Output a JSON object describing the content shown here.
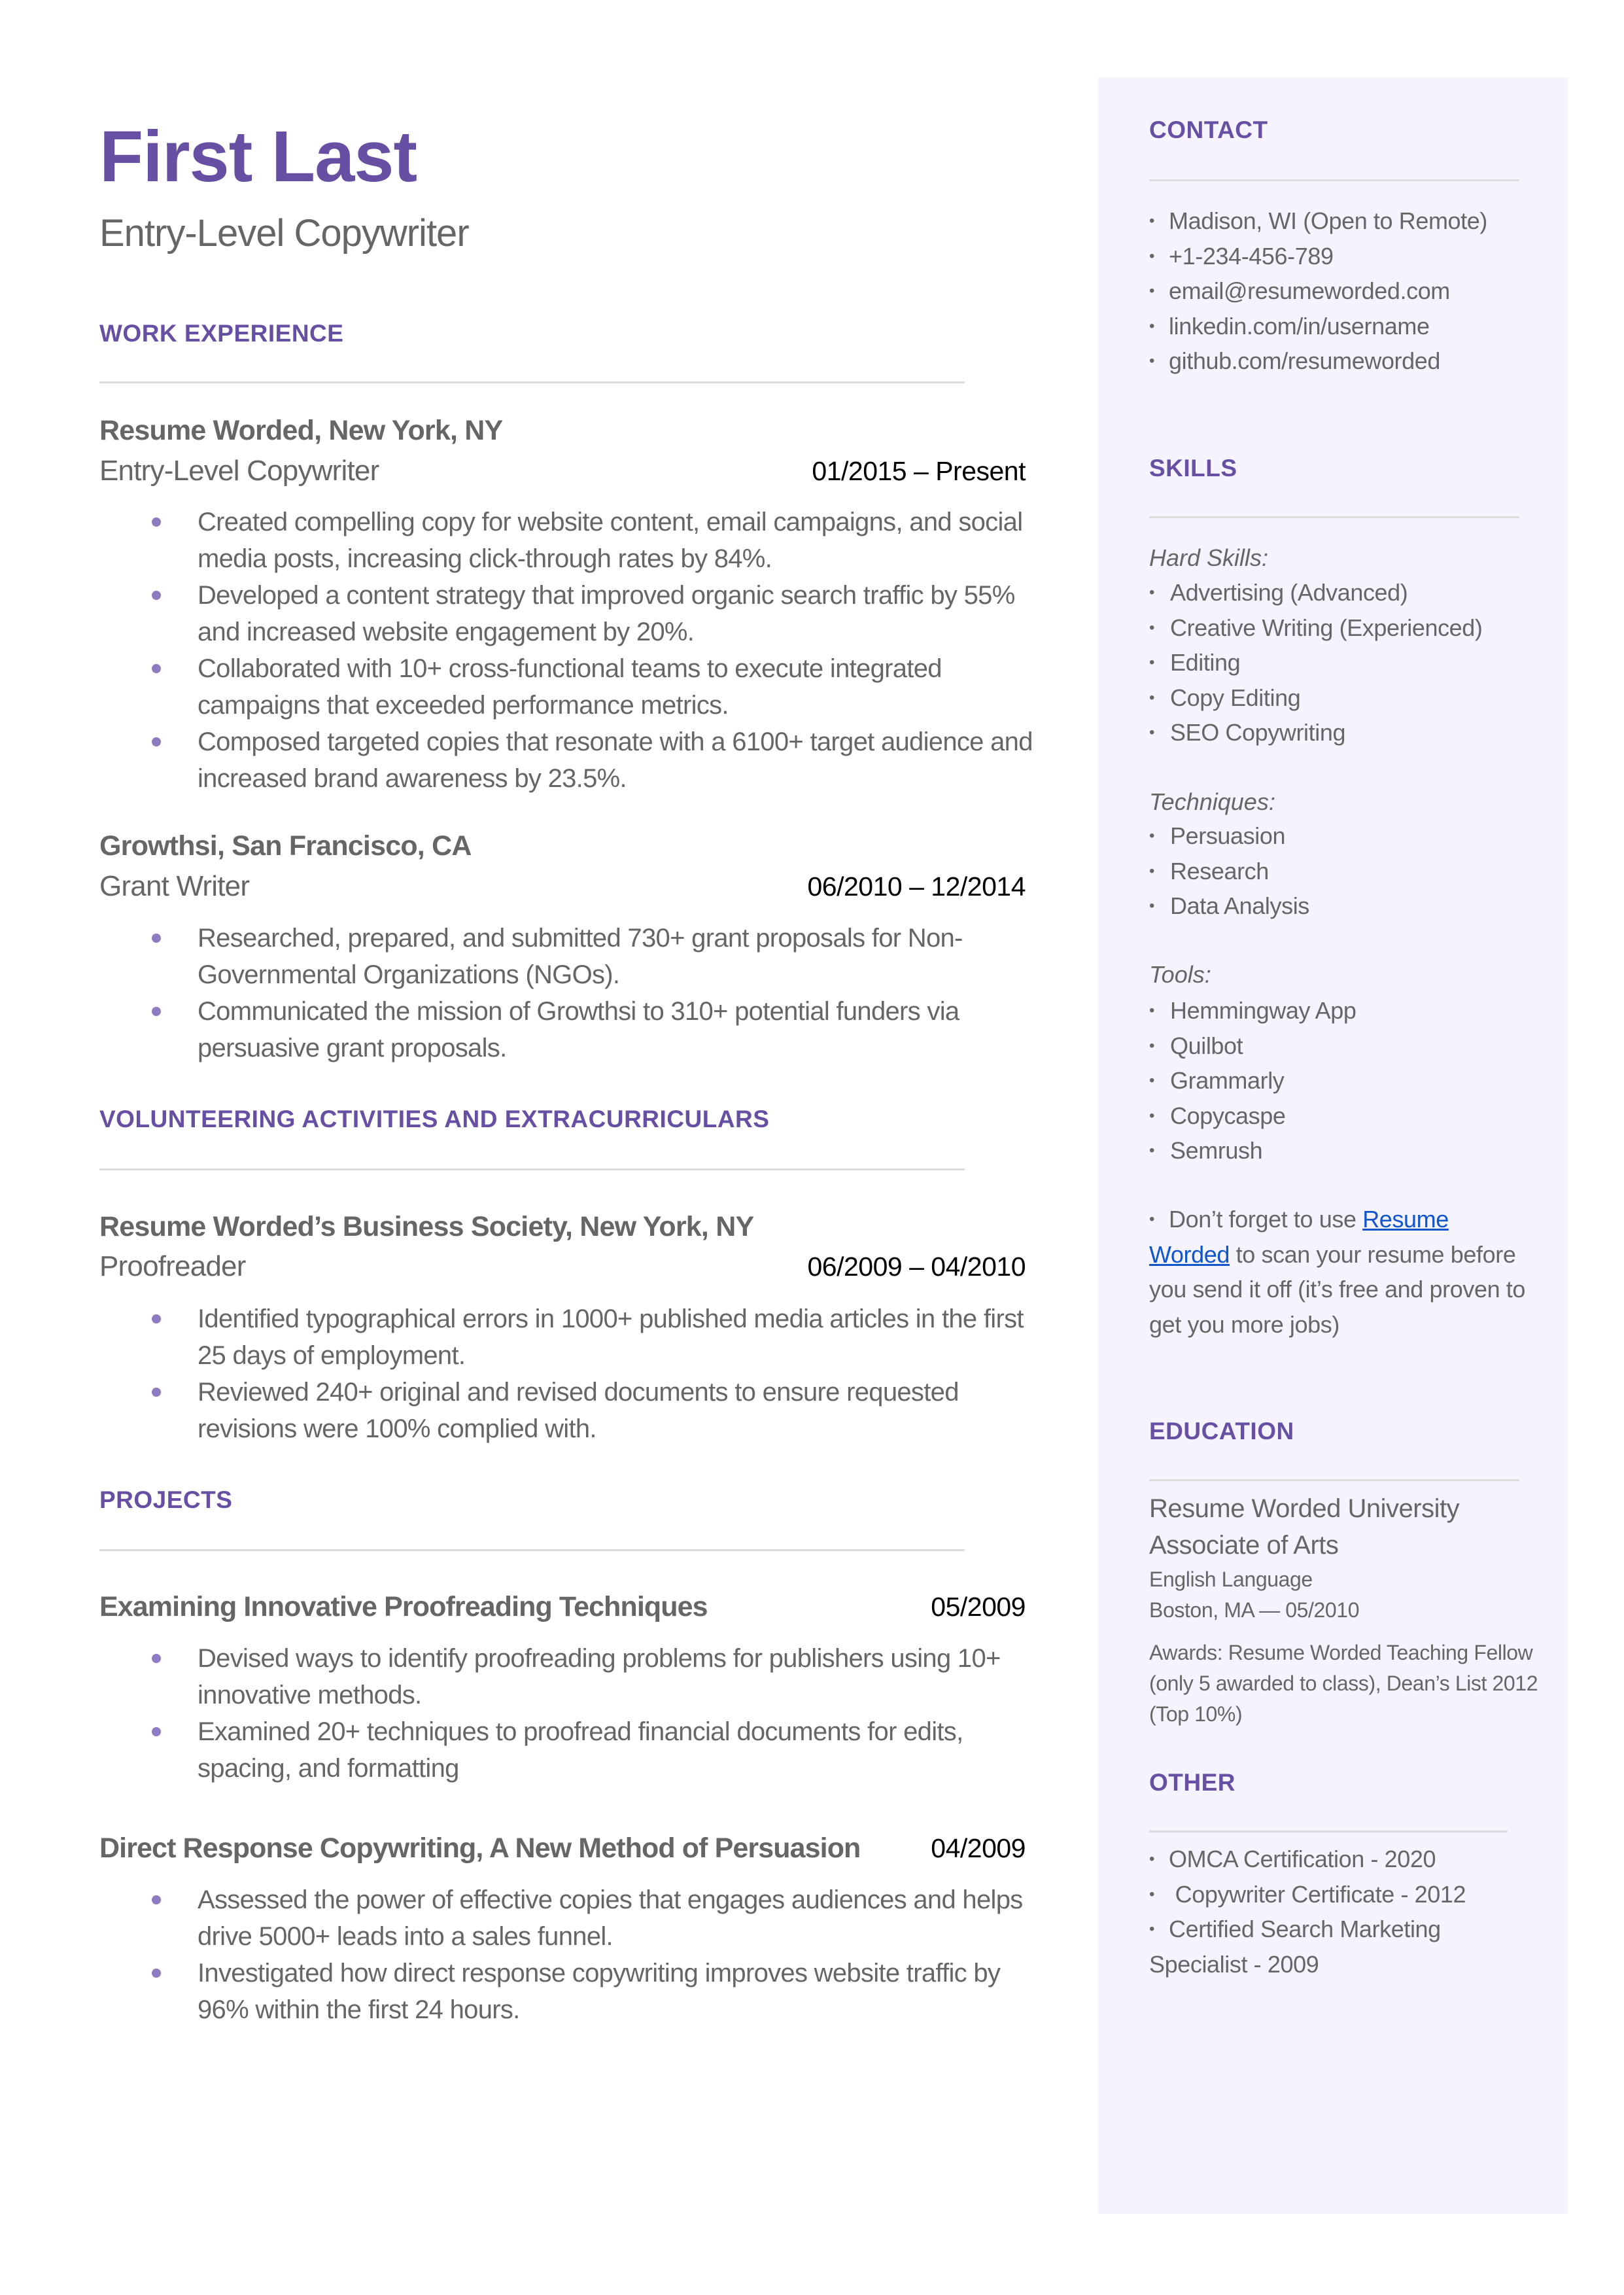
{
  "header": {
    "name": "First Last",
    "headline": "Entry-Level Copywriter"
  },
  "colors": {
    "accent": "#6750A4",
    "bullet": "#8E7CC3",
    "text": "#666666",
    "date": "#000000",
    "sidebar_bg": "#F5F3FE",
    "link": "#1155CC"
  },
  "work_experience": {
    "title": "WORK EXPERIENCE",
    "jobs": [
      {
        "org": "Resume Worded, New York, NY",
        "role": "Entry-Level Copywriter",
        "dates": "01/2015 – Present",
        "bullets": [
          "Created compelling copy for website content, email campaigns, and social media posts, increasing click-through rates by 84%.",
          "Developed a content strategy that improved organic search traffic by 55% and increased website engagement by 20%.",
          "Collaborated with 10+ cross-functional teams to execute integrated campaigns that exceeded performance metrics.",
          "Composed targeted copies that resonate with a 6100+ target audience and increased brand awareness by 23.5%."
        ]
      },
      {
        "org": "Growthsi, San Francisco, CA",
        "role": "Grant Writer",
        "dates": "06/2010 – 12/2014",
        "bullets": [
          "Researched, prepared, and submitted 730+ grant proposals for Non-Governmental Organizations (NGOs).",
          "Communicated the mission of Growthsi to 310+ potential funders via persuasive grant proposals."
        ]
      }
    ]
  },
  "volunteering": {
    "title": "VOLUNTEERING ACTIVITIES AND EXTRACURRICULARS",
    "entries": [
      {
        "org": "Resume Worded’s Business Society, New York, NY",
        "role": "Proofreader",
        "dates": "06/2009 – 04/2010",
        "bullets": [
          "Identified typographical errors in 1000+ published media articles in the first 25 days of employment.",
          "Reviewed 240+ original and revised documents to ensure requested revisions were 100% complied with."
        ]
      }
    ]
  },
  "projects": {
    "title": "PROJECTS",
    "items": [
      {
        "title": "Examining Innovative Proofreading Techniques",
        "date": "05/2009",
        "bullets": [
          "Devised ways to identify proofreading problems for publishers using 10+ innovative methods.",
          "Examined 20+ techniques to proofread financial documents for edits, spacing, and formatting"
        ]
      },
      {
        "title": "Direct Response Copywriting, A New Method of Persuasion",
        "date": "04/2009",
        "bullets": [
          "Assessed the power of effective copies that engages audiences and helps drive 5000+ leads into a sales funnel.",
          "Investigated how direct response copywriting improves website traffic by 96% within the first 24 hours."
        ]
      }
    ]
  },
  "sidebar": {
    "contact": {
      "title": "CONTACT",
      "items": [
        " Madison, WI (Open to Remote)",
        "+1-234-456-789",
        "email@resumeworded.com",
        "linkedin.com/in/username",
        "github.com/resumeworded"
      ]
    },
    "skills": {
      "title": "SKILLS",
      "groups": [
        {
          "label": "Hard Skills:",
          "items": [
            "Advertising (Advanced)",
            "Creative Writing (Experienced)",
            "Editing",
            "Copy Editing",
            "SEO Copywriting"
          ]
        },
        {
          "label": "Techniques:",
          "items": [
            "Persuasion",
            "Research",
            "Data Analysis"
          ]
        },
        {
          "label": "Tools:",
          "items": [
            "Hemmingway App",
            "Quilbot",
            "Grammarly",
            "Copycaspe",
            "Semrush"
          ]
        }
      ],
      "tip": {
        "before": "Don’t forget to use ",
        "link": "Resume Worded",
        "after": " to scan your resume before you send it off (it’s free and proven to get you more jobs)"
      }
    },
    "education": {
      "title": "EDUCATION",
      "school": "Resume Worded University",
      "degree": "Associate of Arts",
      "field": "English Language",
      "location_date": "Boston, MA — 05/2010",
      "awards": "Awards: Resume Worded Teaching Fellow (only 5 awarded to class), Dean’s List 2012 (Top 10%)"
    },
    "other": {
      "title": "OTHER",
      "items": [
        "OMCA Certification - 2020",
        " Copywriter Certificate - 2012",
        "Certified Search Marketing Specialist - 2009"
      ]
    }
  }
}
